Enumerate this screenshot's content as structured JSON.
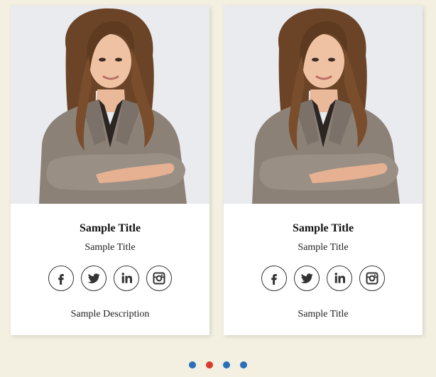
{
  "colors": {
    "page_bg": "#f3efe1",
    "dot_inactive": "#2a6fb8",
    "dot_active": "#d93a2b"
  },
  "cards": [
    {
      "image": "portrait-photo",
      "title": "Sample Title",
      "subtitle": "Sample Title",
      "social": [
        "facebook-icon",
        "twitter-icon",
        "linkedin-icon",
        "instagram-icon"
      ],
      "description": "Sample Description"
    },
    {
      "image": "portrait-photo",
      "title": "Sample Title",
      "subtitle": "Sample Title",
      "social": [
        "facebook-icon",
        "twitter-icon",
        "linkedin-icon",
        "instagram-icon"
      ],
      "description": "Sample Title"
    }
  ],
  "pagination": {
    "count": 4,
    "active_index": 1
  }
}
